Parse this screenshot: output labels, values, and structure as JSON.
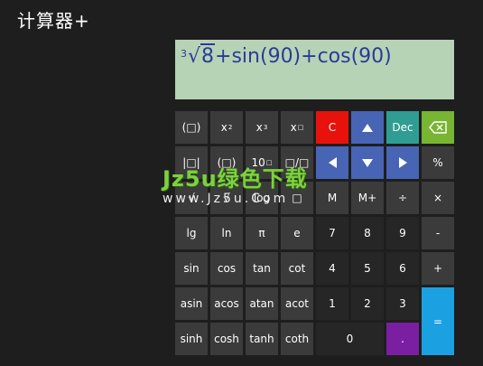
{
  "app": {
    "title": "计算器+"
  },
  "display": {
    "expression": {
      "root_index": "3",
      "radicand": "8",
      "rest": "+sin(90)+cos(90)"
    }
  },
  "keys": {
    "paren": "(□)",
    "square": "x",
    "square_exp": "2",
    "cube": "x",
    "cube_exp": "3",
    "power": "x",
    "power_exp": "□",
    "clear": "C",
    "dec": "Dec",
    "abs": "|□|",
    "paren2": "(□)",
    "ten_pow": "10",
    "ten_pow_exp": "□",
    "fraction": "□/□",
    "percent": "%",
    "sqrt": "√",
    "nth_root": "√",
    "log": "log",
    "mod": "□",
    "mc": "M",
    "mplus": "M+",
    "divide": "÷",
    "multiply": "×",
    "lg": "lg",
    "ln": "ln",
    "pi": "π",
    "e": "e",
    "seven": "7",
    "eight": "8",
    "nine": "9",
    "minus": "-",
    "sin": "sin",
    "cos": "cos",
    "tan": "tan",
    "cot": "cot",
    "four": "4",
    "five": "5",
    "six": "6",
    "plus": "+",
    "asin": "asin",
    "acos": "acos",
    "atan": "atan",
    "acot": "acot",
    "one": "1",
    "two": "2",
    "three": "3",
    "equals": "=",
    "sinh": "sinh",
    "cosh": "cosh",
    "tanh": "tanh",
    "coth": "coth",
    "zero": "0",
    "dot": "."
  },
  "watermark": {
    "line1": "Jz5u绿色下载",
    "line2": "www.Jz5u.Com"
  },
  "colors": {
    "background": "#1e1e1e",
    "display": "#b6d3b5",
    "expression": "#2b3a9a",
    "key": "#3b3b3b",
    "digit_key": "#262626",
    "clear": "#e8120c",
    "arrow": "#4764b5",
    "dec": "#2f9d93",
    "backspace": "#77b532",
    "dot": "#7a1fa2",
    "equals": "#1ba1e2"
  },
  "icons": {
    "up": "arrow-up-icon",
    "down": "arrow-down-icon",
    "left": "arrow-left-icon",
    "right": "arrow-right-icon",
    "backspace": "backspace-icon"
  }
}
